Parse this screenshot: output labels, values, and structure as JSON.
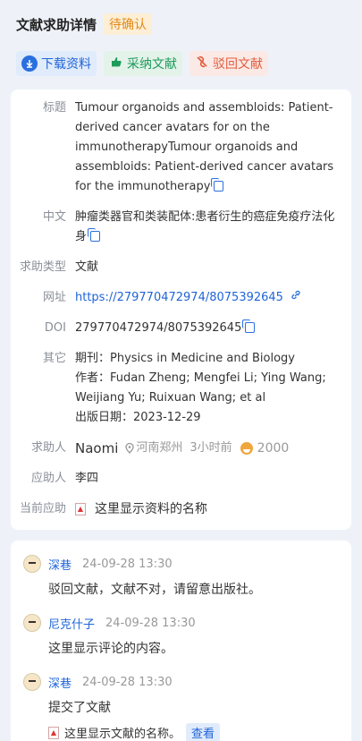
{
  "header": {
    "title": "文献求助详情",
    "status": "待确认"
  },
  "actions": {
    "download": "下载资料",
    "adopt": "采纳文献",
    "reject": "驳回文献"
  },
  "info": {
    "title_label": "标题",
    "title_value": "Tumour organoids and assembloids: Patient-derived cancer avatars for on the immunotherapyTumour organoids and assembloids: Patient-derived cancer avatars for the immunotherapy",
    "cn_label": "中文",
    "cn_value": "肿瘤类器官和类装配体:患者衍生的癌症免疫疗法化身",
    "type_label": "求助类型",
    "type_value": "文献",
    "url_label": "网址",
    "url_value": "https://279770472974/8075392645",
    "doi_label": "DOI",
    "doi_value": "279770472974/8075392645",
    "other_label": "其它",
    "journal": "期刊：Physics in Medicine and Biology",
    "authors": "作者：Fudan Zheng; Mengfei Li; Ying Wang; Weijiang Yu; Ruixuan Wang; et al",
    "date": "出版日期：2023-12-29",
    "seeker_label": "求助人",
    "seeker_name": "Naomi",
    "seeker_loc": "河南郑州",
    "seeker_time": "3小时前",
    "seeker_points": "2000",
    "helper_label": "应助人",
    "helper_name": "李四",
    "current_label": "当前应助",
    "current_value": "这里显示资料的名称"
  },
  "comments": [
    {
      "name": "深巷",
      "time": "24-09-28 13:30",
      "text": "驳回文献，文献不对，请留意出版社。"
    },
    {
      "name": "尼克什子",
      "time": "24-09-28 13:30",
      "text": "这里显示评论的内容。"
    },
    {
      "name": "深巷",
      "time": "24-09-28 13:30",
      "text": "提交了文献",
      "file": "这里显示文献的名称。",
      "view": "查看"
    }
  ],
  "colors": {
    "accent": "#1f64d8",
    "pending": "#e48a16",
    "adopt": "#1f9a5a",
    "reject": "#e25d3c"
  }
}
